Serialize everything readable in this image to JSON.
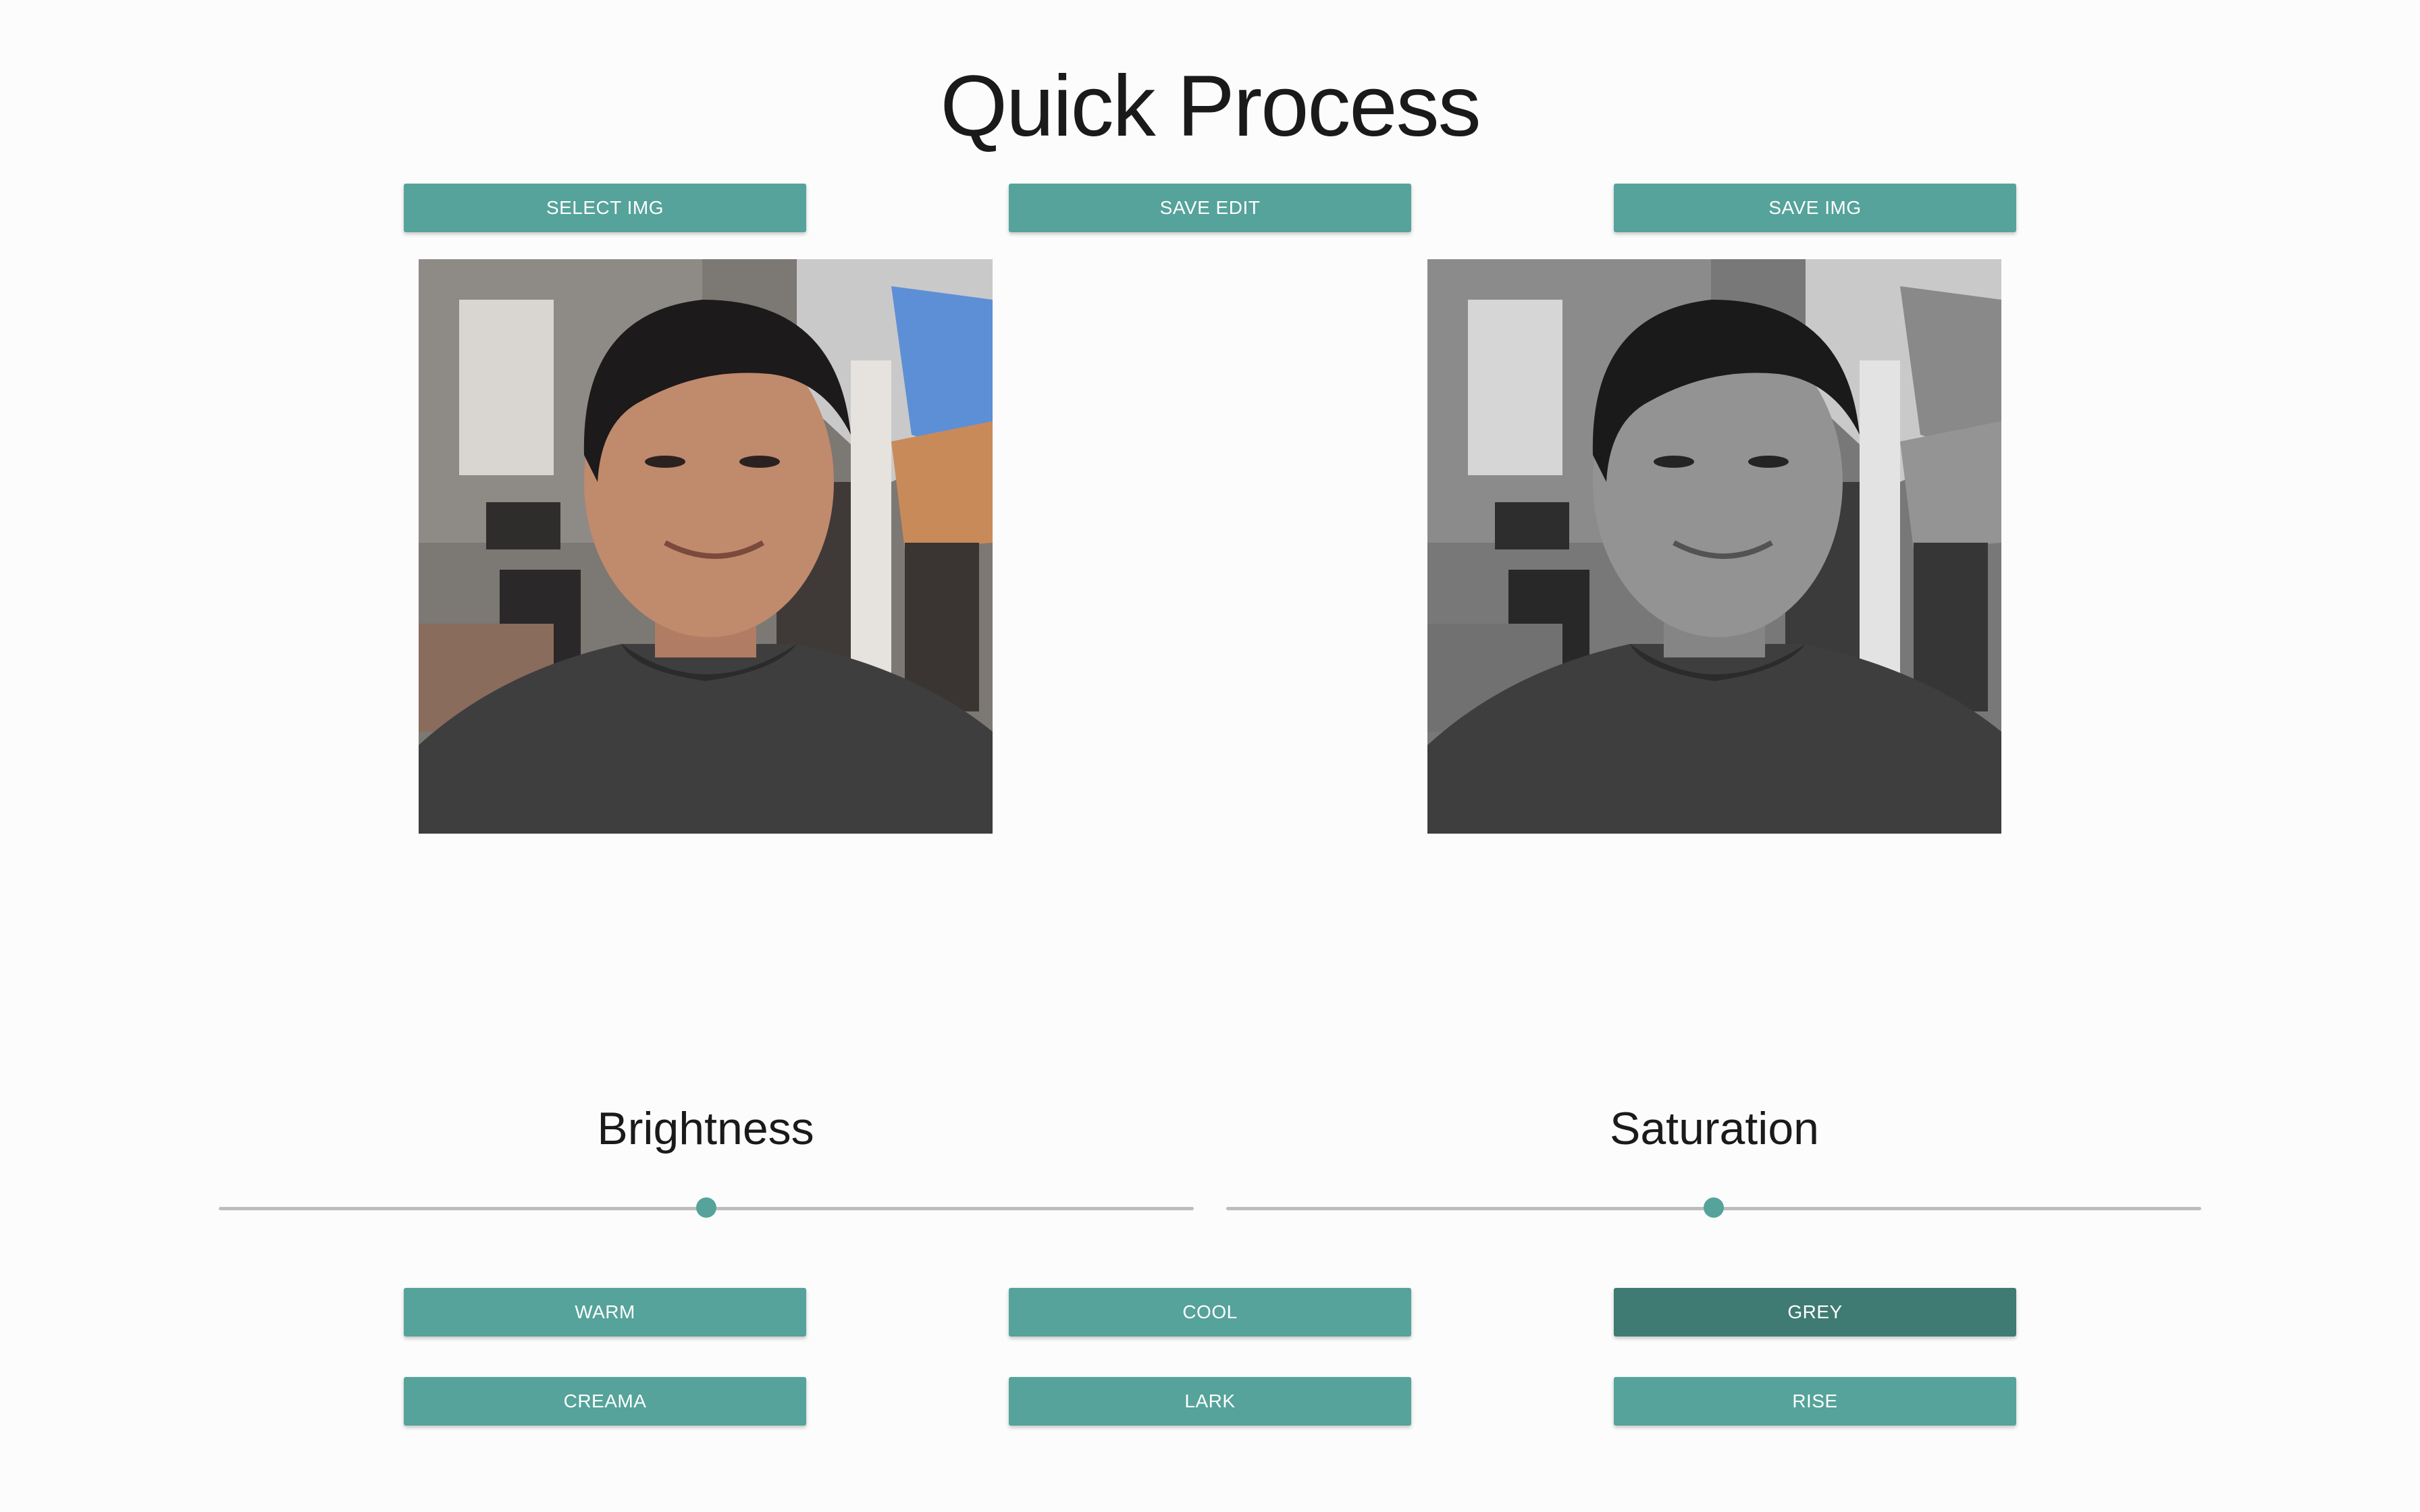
{
  "app": {
    "title": "Quick Process"
  },
  "toolbar": {
    "select_label": "SELECT IMG",
    "save_edit_label": "SAVE EDIT",
    "save_img_label": "SAVE IMG"
  },
  "controls": {
    "brightness": {
      "label": "Brightness",
      "value": 0.5
    },
    "saturation": {
      "label": "Saturation",
      "value": 0.5
    }
  },
  "filters": {
    "warm": "WARM",
    "cool": "COOL",
    "grey": "GREY",
    "creama": "CREAMA",
    "lark": "LARK",
    "rise": "RISE",
    "active": "grey"
  },
  "colors": {
    "accent": "#55a39a",
    "accent_active": "#3f7b72",
    "background": "#fcfcfc"
  }
}
